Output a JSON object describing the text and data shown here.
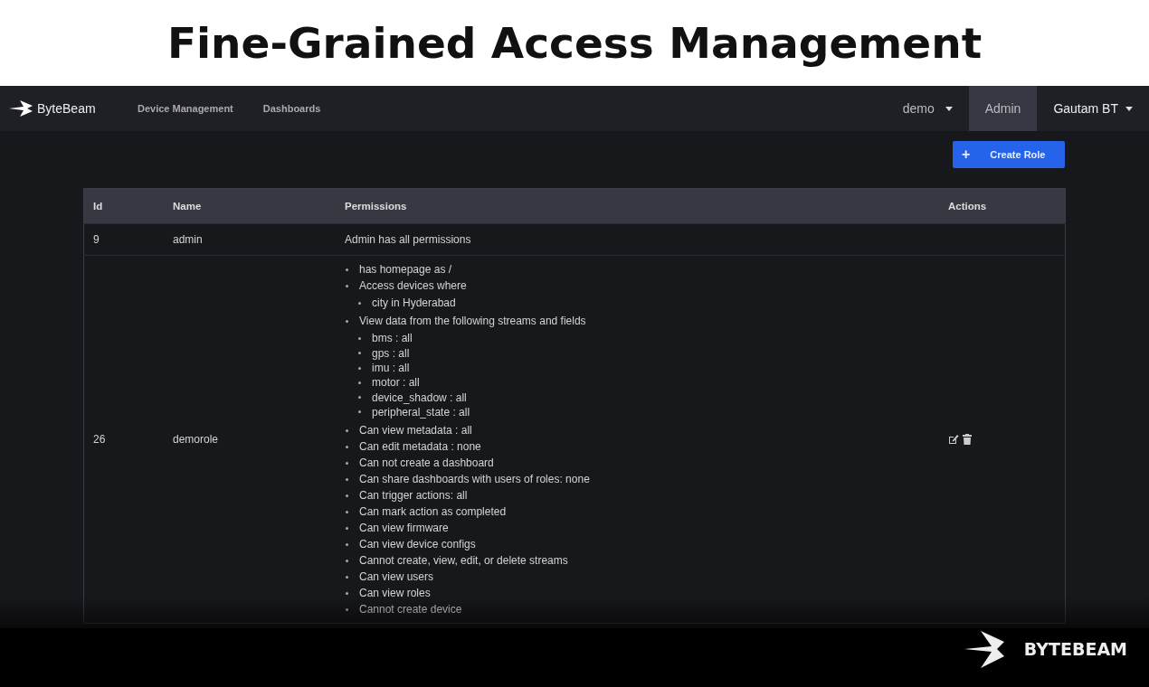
{
  "slide_title": "Fine-Grained Access Management",
  "navbar": {
    "brand": "ByteBeam",
    "links": [
      {
        "label": "Device Management",
        "selected": false
      },
      {
        "label": "Dashboards",
        "selected": false
      }
    ],
    "right": [
      {
        "label": "demo",
        "kind": "dropdown",
        "selected": false
      },
      {
        "label": "Admin",
        "kind": "link",
        "selected": true
      },
      {
        "label": "Gautam BT",
        "kind": "dropdown",
        "selected": false
      }
    ]
  },
  "create_button": {
    "icon": "+",
    "label": "Create Role"
  },
  "table": {
    "columns": [
      "Id",
      "Name",
      "Permissions",
      "Actions"
    ],
    "rows": [
      {
        "id": "9",
        "name": "admin",
        "permissions_text": "Admin has all permissions",
        "actions": false
      },
      {
        "id": "26",
        "name": "demorole",
        "actions": true,
        "permissions": [
          {
            "text": "has homepage as /"
          },
          {
            "text": "Access devices where",
            "children": [
              {
                "text": "city in Hyderabad"
              }
            ]
          },
          {
            "text": "View data from the following streams and fields",
            "children": [
              {
                "text": "bms : all"
              },
              {
                "text": "gps : all"
              },
              {
                "text": "imu : all"
              },
              {
                "text": "motor : all"
              },
              {
                "text": "device_shadow : all"
              },
              {
                "text": "peripheral_state : all"
              }
            ]
          },
          {
            "text": "Can view metadata : all"
          },
          {
            "text": "Can edit metadata : none"
          },
          {
            "text": "Can not create a dashboard"
          },
          {
            "text": "Can share dashboards with users of roles: none"
          },
          {
            "text": "Can trigger actions: all"
          },
          {
            "text": "Can mark action as completed"
          },
          {
            "text": "Can view firmware"
          },
          {
            "text": "Can view device configs"
          },
          {
            "text": "Cannot create, view, edit, or delete streams"
          },
          {
            "text": "Can view users"
          },
          {
            "text": "Can view roles"
          },
          {
            "text": "Cannot create device"
          }
        ]
      }
    ]
  },
  "footer": {
    "brand": "BYTEBEAM"
  }
}
